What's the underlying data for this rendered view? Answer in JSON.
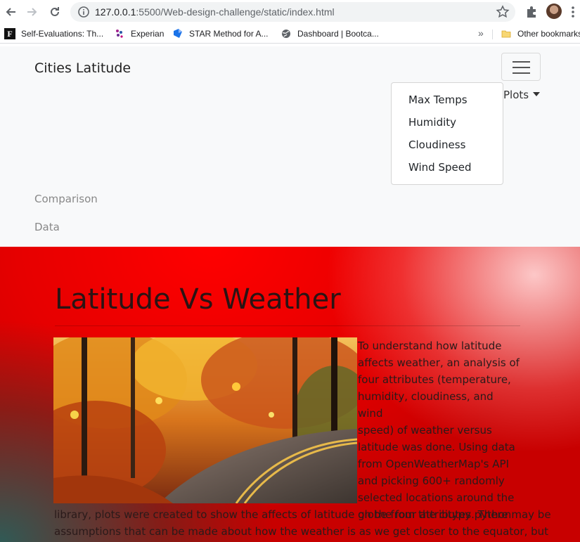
{
  "browser": {
    "url_host": "127.0.0.1",
    "url_path": ":5500/Web-design-challenge/static/index.html",
    "bookmarks": [
      {
        "label": "Self-Evaluations: Th...",
        "icon": "f-logo-icon"
      },
      {
        "label": "Experian",
        "icon": "experian-icon"
      },
      {
        "label": "STAR Method for A...",
        "icon": "star-method-icon"
      },
      {
        "label": "Dashboard | Bootca...",
        "icon": "globe-icon"
      }
    ],
    "more": "»",
    "other_bookmarks": "Other bookmarks"
  },
  "navbar": {
    "brand": "Cities Latitude",
    "plots_label": "Plots",
    "dropdown": [
      "Max Temps",
      "Humidity",
      "Cloudiness",
      "Wind Speed"
    ],
    "links": [
      "Comparison",
      "Data"
    ]
  },
  "hero": {
    "title": "Latitude Vs Weather",
    "text_side": [
      "To understand how latitude",
      "affects weather, an analysis of",
      "four attributes (temperature,",
      "humidity, cloudiness, and wind",
      "speed) of weather versus",
      "latitude was done. Using data",
      "from OpenWeatherMap's API",
      "and picking 600+ randomly",
      "selected locations around the",
      "globe from the citypy python"
    ],
    "text_full": [
      "library, plots were created to show the affects of latitude on the four attributes. There may be",
      "assumptions that can be made about how the weather is as we get closer to the equator, but"
    ]
  },
  "colors": {
    "hero_red": "#ff0000",
    "hero_teal": "#285f5a",
    "nav_bg": "#f8f9fa"
  }
}
